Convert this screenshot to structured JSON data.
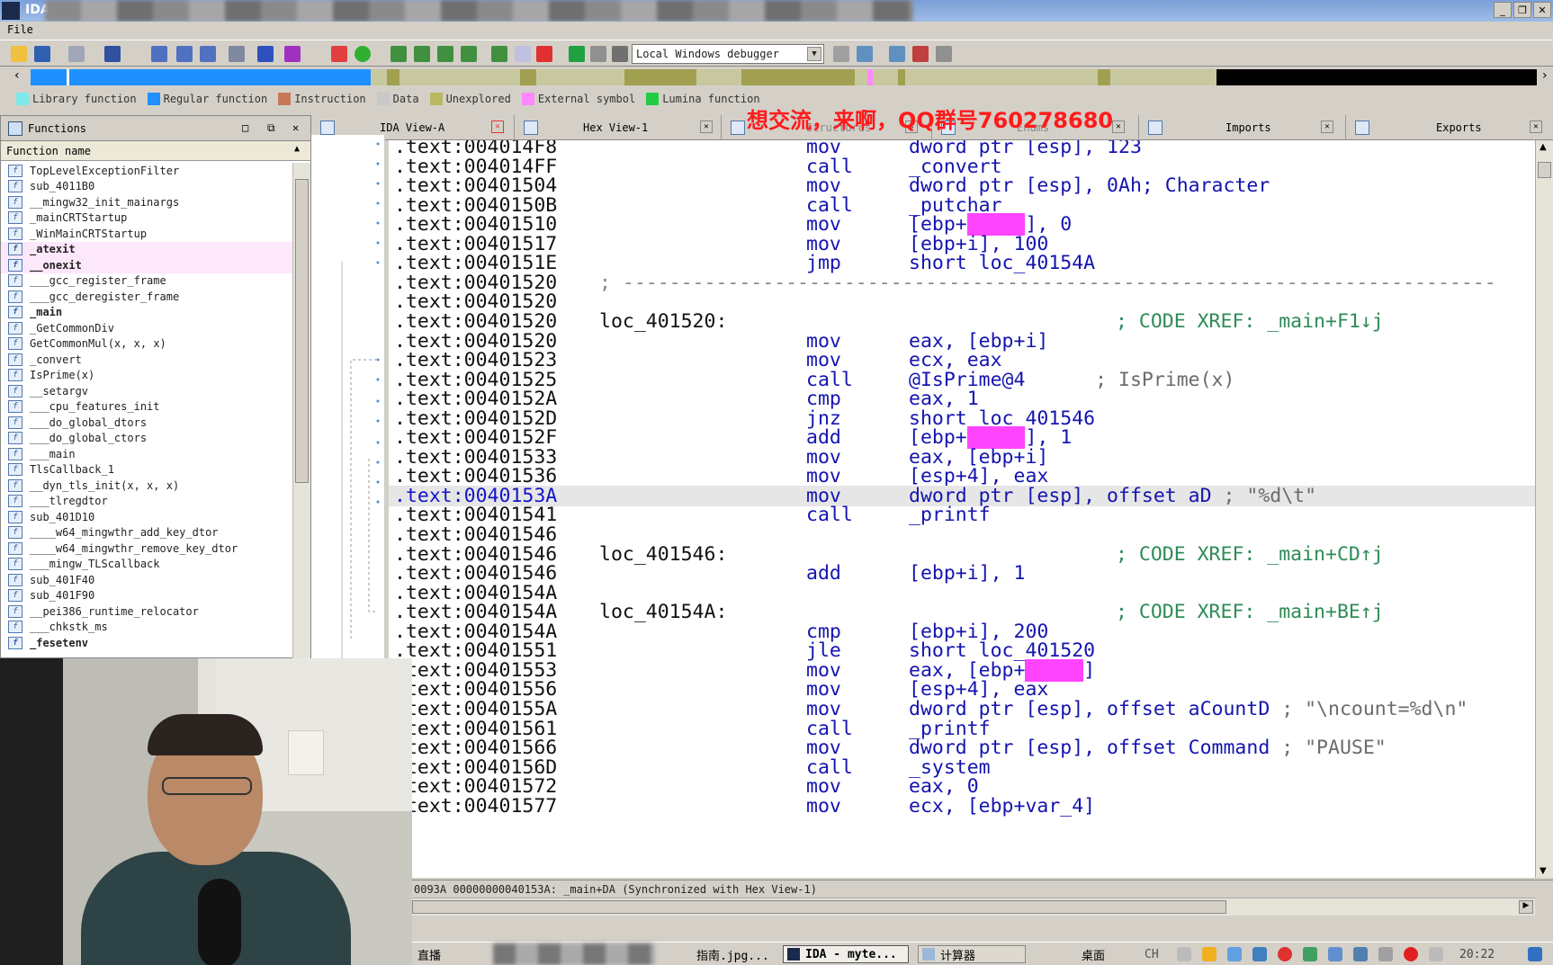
{
  "window": {
    "app_title": "IDA",
    "controls": [
      "_",
      "❐",
      "✕"
    ]
  },
  "menu": {
    "file": "File"
  },
  "toolbar": {
    "debugger_select": "Local Windows debugger"
  },
  "legend": [
    {
      "label": "Library function",
      "color": "#7fe8e8"
    },
    {
      "label": "Regular function",
      "color": "#1e90ff"
    },
    {
      "label": "Instruction",
      "color": "#c8785a"
    },
    {
      "label": "Data",
      "color": "#c8c8c8"
    },
    {
      "label": "Unexplored",
      "color": "#b8b860"
    },
    {
      "label": "External symbol",
      "color": "#ff88ff"
    },
    {
      "label": "Lumina function",
      "color": "#22cc44"
    }
  ],
  "watermark": "想交流，来啊，QQ群号760278680",
  "functions_pane": {
    "title": "Functions",
    "column_header": "Function name",
    "items": [
      {
        "name": "TopLevelExceptionFilter",
        "style": ""
      },
      {
        "name": "sub_4011B0",
        "style": ""
      },
      {
        "name": "__mingw32_init_mainargs",
        "style": ""
      },
      {
        "name": "_mainCRTStartup",
        "style": ""
      },
      {
        "name": "_WinMainCRTStartup",
        "style": ""
      },
      {
        "name": "_atexit",
        "style": "sel bold"
      },
      {
        "name": "__onexit",
        "style": "sel bold"
      },
      {
        "name": "___gcc_register_frame",
        "style": ""
      },
      {
        "name": "___gcc_deregister_frame",
        "style": ""
      },
      {
        "name": "_main",
        "style": "bold"
      },
      {
        "name": "_GetCommonDiv",
        "style": ""
      },
      {
        "name": "GetCommonMul(x, x, x)",
        "style": ""
      },
      {
        "name": "_convert",
        "style": ""
      },
      {
        "name": "IsPrime(x)",
        "style": ""
      },
      {
        "name": "__setargv",
        "style": ""
      },
      {
        "name": "___cpu_features_init",
        "style": ""
      },
      {
        "name": "___do_global_dtors",
        "style": ""
      },
      {
        "name": "___do_global_ctors",
        "style": ""
      },
      {
        "name": "___main",
        "style": ""
      },
      {
        "name": "TlsCallback_1",
        "style": ""
      },
      {
        "name": "__dyn_tls_init(x, x, x)",
        "style": ""
      },
      {
        "name": "___tlregdtor",
        "style": ""
      },
      {
        "name": "sub_401D10",
        "style": ""
      },
      {
        "name": "____w64_mingwthr_add_key_dtor",
        "style": ""
      },
      {
        "name": "____w64_mingwthr_remove_key_dtor",
        "style": ""
      },
      {
        "name": "___mingw_TLScallback",
        "style": ""
      },
      {
        "name": "sub_401F40",
        "style": ""
      },
      {
        "name": "sub_401F90",
        "style": ""
      },
      {
        "name": "__pei386_runtime_relocator",
        "style": ""
      },
      {
        "name": "___chkstk_ms",
        "style": ""
      },
      {
        "name": "_fesetenv",
        "style": "bold"
      }
    ]
  },
  "tabs": [
    {
      "label": "IDA View-A",
      "active": true
    },
    {
      "label": "Hex View-1",
      "active": false
    },
    {
      "label": "Structures",
      "active": false
    },
    {
      "label": "Enums",
      "active": false
    },
    {
      "label": "Imports",
      "active": false
    },
    {
      "label": "Exports",
      "active": false
    }
  ],
  "disasm": {
    "lines": [
      {
        "addr": ".text:004014F8",
        "mnem": "mov",
        "ops": "dword ptr [esp], 123"
      },
      {
        "addr": ".text:004014FF",
        "mnem": "call",
        "ops": "_convert"
      },
      {
        "addr": ".text:00401504",
        "mnem": "mov",
        "ops": "dword ptr [esp], 0Ah",
        "cmt": "; Character"
      },
      {
        "addr": ".text:0040150B",
        "mnem": "call",
        "ops": "_putchar"
      },
      {
        "addr": ".text:00401510",
        "mnem": "mov",
        "ops_pre": "[ebp+",
        "var": "var_C",
        "ops_post": "], 0"
      },
      {
        "addr": ".text:00401517",
        "mnem": "mov",
        "ops": "[ebp+i], 100"
      },
      {
        "addr": ".text:0040151E",
        "mnem": "jmp",
        "ops": "short loc_40154A"
      },
      {
        "addr": ".text:00401520",
        "sep": "; ---------------------------------------------------------------------------"
      },
      {
        "addr": ".text:00401520"
      },
      {
        "addr": ".text:00401520",
        "label": "loc_401520:",
        "xref": "; CODE XREF: _main+F1↓j"
      },
      {
        "addr": ".text:00401520",
        "mnem": "mov",
        "ops": "eax, [ebp+i]"
      },
      {
        "addr": ".text:00401523",
        "mnem": "mov",
        "ops": "ecx, eax"
      },
      {
        "addr": ".text:00401525",
        "mnem": "call",
        "ops": "@IsPrime@4",
        "cmt": "      ; IsPrime(x)"
      },
      {
        "addr": ".text:0040152A",
        "mnem": "cmp",
        "ops": "eax, 1"
      },
      {
        "addr": ".text:0040152D",
        "mnem": "jnz",
        "ops": "short loc_401546"
      },
      {
        "addr": ".text:0040152F",
        "mnem": "add",
        "ops_pre": "[ebp+",
        "var": "var_C",
        "ops_post": "], 1"
      },
      {
        "addr": ".text:00401533",
        "mnem": "mov",
        "ops": "eax, [ebp+i]"
      },
      {
        "addr": ".text:00401536",
        "mnem": "mov",
        "ops": "[esp+4], eax"
      },
      {
        "addr": ".text:0040153A",
        "mnem": "mov",
        "ops": "dword ptr [esp], offset aD",
        "cmt": " ; \"%d\\t\"",
        "hl": true
      },
      {
        "addr": ".text:00401541",
        "mnem": "call",
        "ops": "_printf"
      },
      {
        "addr": ".text:00401546"
      },
      {
        "addr": ".text:00401546",
        "label": "loc_401546:",
        "xref": "; CODE XREF: _main+CD↑j"
      },
      {
        "addr": ".text:00401546",
        "mnem": "add",
        "ops": "[ebp+i], 1"
      },
      {
        "addr": ".text:0040154A"
      },
      {
        "addr": ".text:0040154A",
        "label": "loc_40154A:",
        "xref": "; CODE XREF: _main+BE↑j"
      },
      {
        "addr": ".text:0040154A",
        "mnem": "cmp",
        "ops": "[ebp+i], 200"
      },
      {
        "addr": ".text:00401551",
        "mnem": "jle",
        "ops": "short loc_401520"
      },
      {
        "addr": ".text:00401553",
        "mnem": "mov",
        "ops_pre": "eax, [ebp+",
        "var": "var_C",
        "ops_post": "]"
      },
      {
        "addr": ".text:00401556",
        "mnem": "mov",
        "ops": "[esp+4], eax"
      },
      {
        "addr": ".text:0040155A",
        "mnem": "mov",
        "ops": "dword ptr [esp], offset aCountD",
        "cmt": " ; \"\\ncount=%d\\n\""
      },
      {
        "addr": ".text:00401561",
        "mnem": "call",
        "ops": "_printf"
      },
      {
        "addr": ".text:00401566",
        "mnem": "mov",
        "ops": "dword ptr [esp], offset Command",
        "cmt": " ; \"PAUSE\""
      },
      {
        "addr": ".text:0040156D",
        "mnem": "call",
        "ops": "_system"
      },
      {
        "addr": ".text:00401572",
        "mnem": "mov",
        "ops": "eax, 0"
      },
      {
        "addr": ".text:00401577",
        "mnem": "mov",
        "ops": "ecx, [ebp+var_4]"
      }
    ]
  },
  "status_line": "0093A 00000000040153A: _main+DA (Synchronized with Hex View-1)",
  "taskbar": {
    "item1": "直播",
    "item2": "指南.jpg...",
    "item3": "IDA - myte...",
    "item4": "计算器",
    "desk": "桌面",
    "ime": "CH",
    "clock": "20:22"
  }
}
